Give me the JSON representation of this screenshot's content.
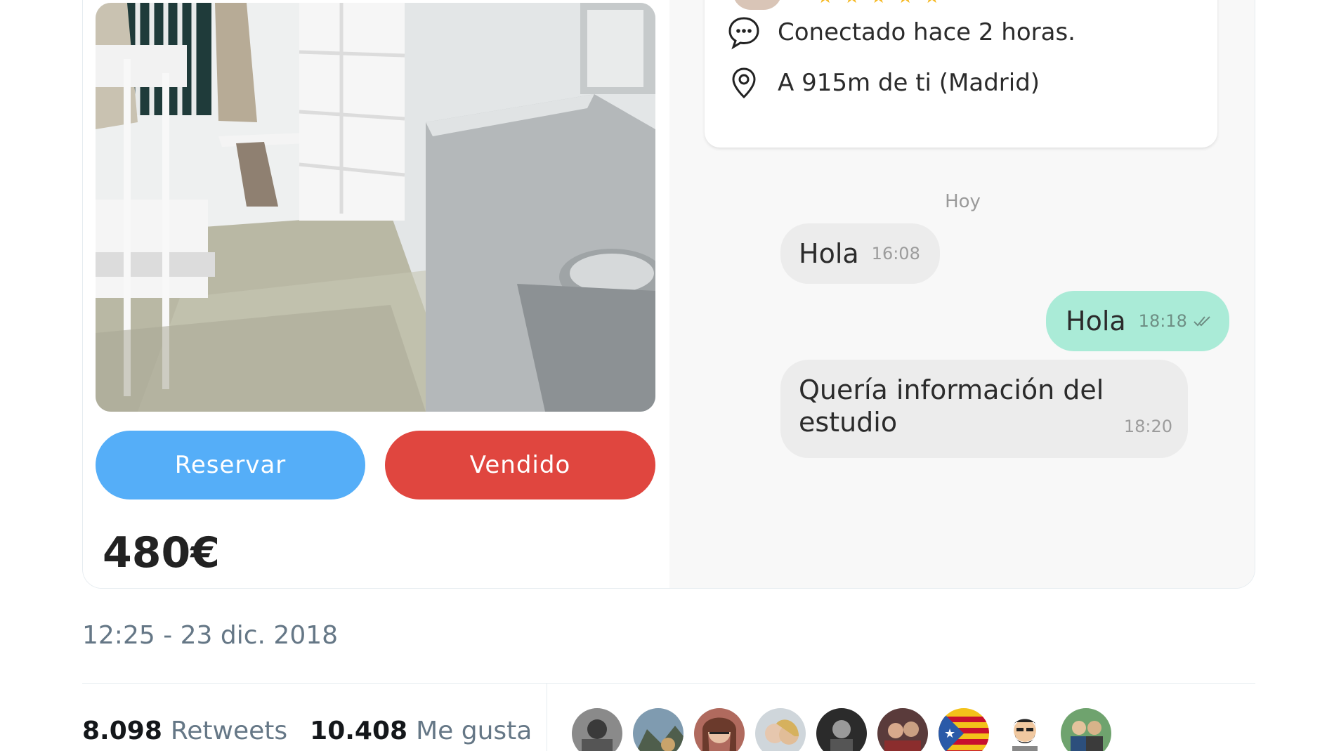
{
  "listing": {
    "reserve_label": "Reservar",
    "sold_label": "Vendido",
    "price": "480€"
  },
  "profile": {
    "rating_stars": 5,
    "online_text": "Conectado hace 2 horas.",
    "distance_text": "A 915m de ti (Madrid)"
  },
  "chat": {
    "day_label": "Hoy",
    "messages": [
      {
        "text": "Hola",
        "time": "16:08",
        "direction": "incoming"
      },
      {
        "text": "Hola",
        "time": "18:18",
        "direction": "outgoing",
        "status": "read"
      },
      {
        "text": "Quería información del estudio",
        "time": "18:20",
        "direction": "incoming"
      }
    ]
  },
  "tweet": {
    "timestamp": "12:25 - 23 dic. 2018",
    "retweets_count": "8.098",
    "retweets_label": "Retweets",
    "likes_count": "10.408",
    "likes_label": "Me gusta"
  },
  "likers": [
    "avatar-1",
    "avatar-2",
    "avatar-3",
    "avatar-4",
    "avatar-5",
    "avatar-6",
    "avatar-7",
    "avatar-8",
    "avatar-9"
  ],
  "colors": {
    "reserve_button": "#55aef8",
    "sold_button": "#e0463f",
    "outgoing_bubble": "#aaebd7",
    "incoming_bubble": "#ececec",
    "star": "#f6b81f",
    "muted_text": "#657786"
  }
}
